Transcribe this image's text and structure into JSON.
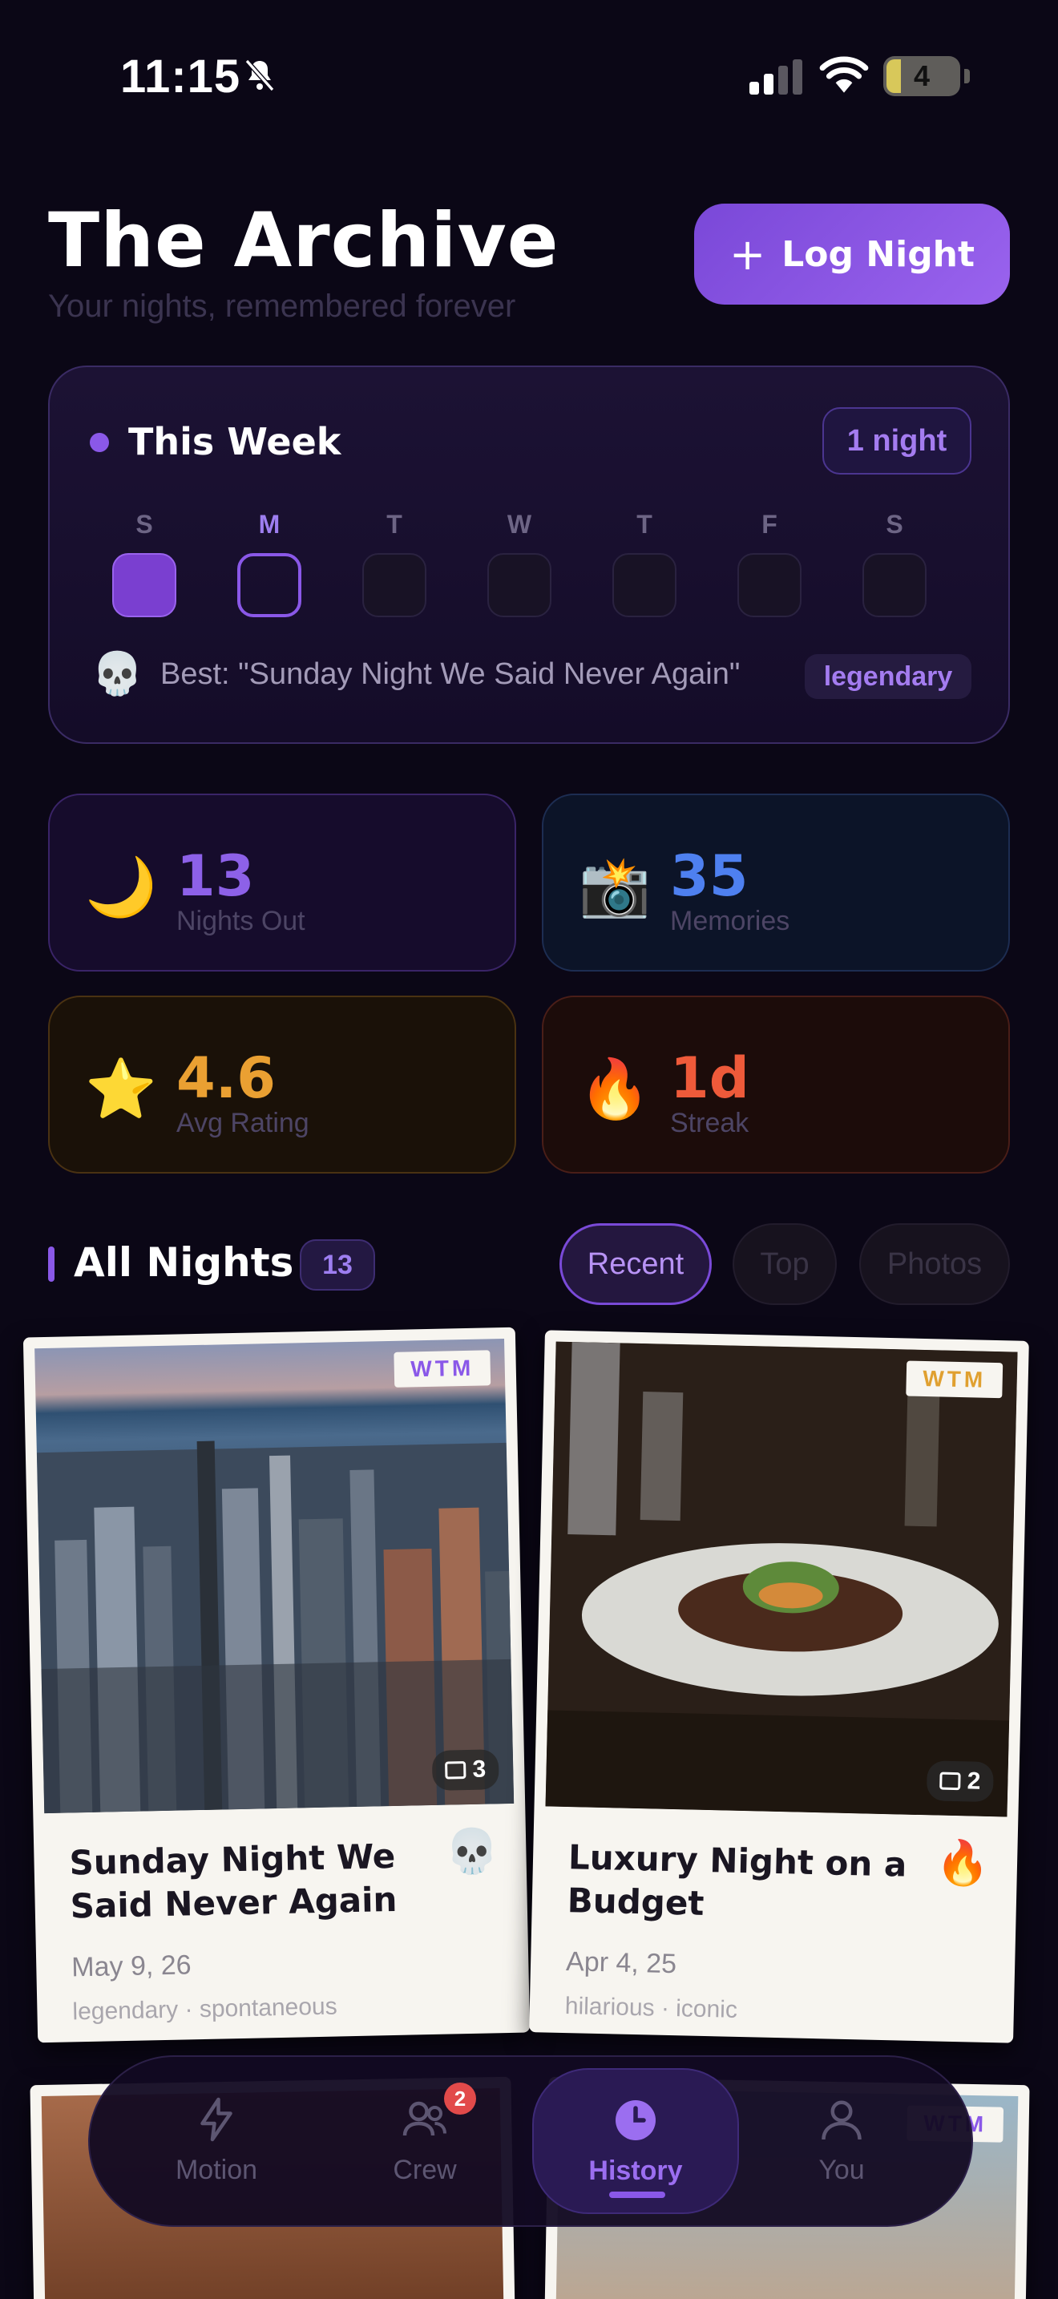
{
  "status": {
    "time": "11:15",
    "battery": "4"
  },
  "header": {
    "title": "The Archive",
    "subtitle": "Your nights, remembered forever",
    "log_button": "Log Night"
  },
  "week": {
    "title": "This Week",
    "badge": "1 night",
    "days": [
      "S",
      "M",
      "T",
      "W",
      "T",
      "F",
      "S"
    ],
    "best_emoji": "💀",
    "best_text": "Best: \"Sunday Night We Said Never Again\"",
    "best_tag": "legendary"
  },
  "stats": [
    {
      "emoji": "🌙",
      "value": "13",
      "label": "Nights Out"
    },
    {
      "emoji": "📸",
      "value": "35",
      "label": "Memories"
    },
    {
      "emoji": "⭐",
      "value": "4.6",
      "label": "Avg Rating"
    },
    {
      "emoji": "🔥",
      "value": "1d",
      "label": "Streak"
    }
  ],
  "all_nights": {
    "title": "All Nights",
    "count": "13",
    "filters": [
      "Recent",
      "Top",
      "Photos"
    ]
  },
  "cards": [
    {
      "badge": "WTM",
      "photo_count": "3",
      "title": "Sunday Night We Said Never Again",
      "emoji": "💀",
      "date": "May 9, 26",
      "tags": "legendary · spontaneous"
    },
    {
      "badge": "WTM",
      "photo_count": "2",
      "title": "Luxury Night on a Budget",
      "emoji": "🔥",
      "date": "Apr 4, 25",
      "tags": "hilarious · iconic"
    },
    {
      "badge": "WTM"
    }
  ],
  "nav": {
    "motion": "Motion",
    "crew": "Crew",
    "crew_badge": "2",
    "history": "History",
    "you": "You"
  }
}
